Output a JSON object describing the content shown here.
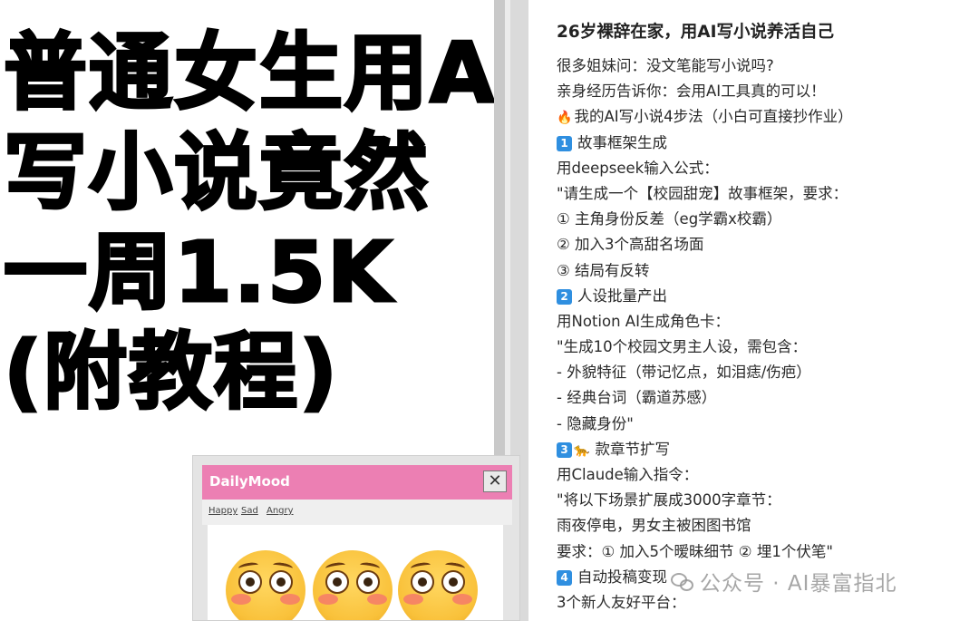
{
  "left_panel": {
    "headline_lines": [
      "普通女生用AI",
      "写小说竟然",
      "一周1.5K",
      "(附教程)"
    ]
  },
  "daily_mood_window": {
    "title": "DailyMood",
    "close_symbol": "✕",
    "menu": [
      "Happy",
      "Sad",
      "Angry"
    ],
    "emoji_names": [
      "flushed-face",
      "flushed-face",
      "flushed-face"
    ],
    "titlebar_color": "#ec7fb3"
  },
  "article": {
    "title": "26岁裸辞在家，用AI写小说养活自己",
    "lines": [
      {
        "text": "很多姐妹问：没文笔能写小说吗?"
      },
      {
        "text": "亲身经历告诉你：会用AI工具真的可以！"
      },
      {
        "icon": "🔥",
        "icon_name": "fire-icon",
        "text": "我的AI写小说4步法（小白可直接抄作业）"
      },
      {
        "badge": "1",
        "text": "故事框架生成"
      },
      {
        "text": "用deepseek输入公式："
      },
      {
        "text": "\"请生成一个【校园甜宠】故事框架，要求："
      },
      {
        "text": "① 主角身份反差（eg学霸x校霸）"
      },
      {
        "text": "② 加入3个高甜名场面"
      },
      {
        "text": "③ 结局有反转"
      },
      {
        "badge": "2",
        "text": "人设批量产出"
      },
      {
        "text": "用Notion AI生成角色卡："
      },
      {
        "text": "\"生成10个校园文男主人设，需包含："
      },
      {
        "text": "- 外貌特征（带记忆点，如泪痣/伤疤）"
      },
      {
        "text": "- 经典台词（霸道苏感）"
      },
      {
        "text": "- 隐藏身份\""
      },
      {
        "badge": "3",
        "icon": "🐆",
        "icon_name": "leopard-icon",
        "text": "款章节扩写"
      },
      {
        "text": "用Claude输入指令："
      },
      {
        "text": "\"将以下场景扩展成3000字章节："
      },
      {
        "text": "雨夜停电，男女主被困图书馆"
      },
      {
        "text": "要求：① 加入5个暧昧细节 ② 埋1个伏笔\""
      },
      {
        "badge": "4",
        "text": "自动投稿变现"
      },
      {
        "text": "3个新人友好平台："
      }
    ],
    "badge_color": "#2f8fe0"
  },
  "watermark": {
    "text": "公众号 · AI暴富指北"
  }
}
